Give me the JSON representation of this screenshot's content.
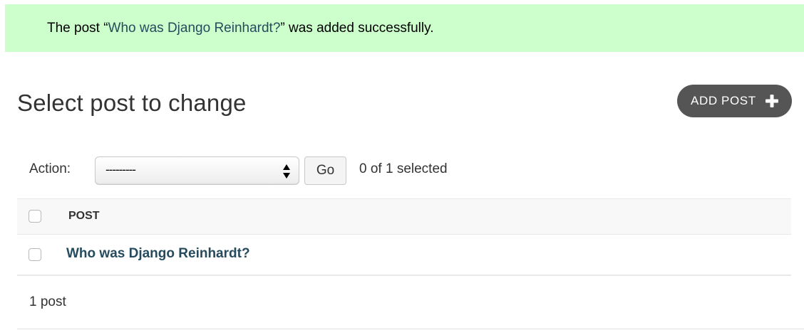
{
  "message": {
    "prefix": "The post “",
    "link_text": "Who was Django Reinhardt?",
    "suffix": "” was added successfully.",
    "color": "#ccffcc"
  },
  "page": {
    "title": "Select post to change",
    "add_button": "ADD POST",
    "add_icon": "plus-icon"
  },
  "actions": {
    "label": "Action:",
    "select_value": "---------",
    "select_icon": "select-arrows-icon",
    "go_label": "Go",
    "counter": "0 of 1 selected"
  },
  "table": {
    "columns": [
      "POST"
    ],
    "rows": [
      {
        "title": "Who was Django Reinhardt?",
        "checked": false
      }
    ],
    "select_all_checked": false,
    "link_color": "#264b5d"
  },
  "paginator": {
    "count": "1 post"
  }
}
